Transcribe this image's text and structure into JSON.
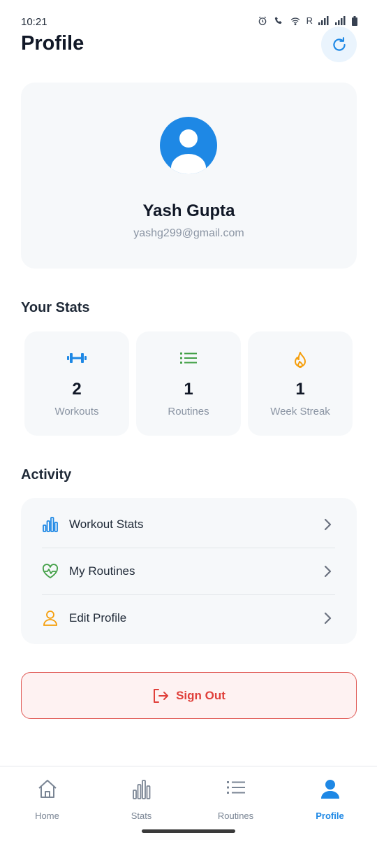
{
  "status_bar": {
    "time": "10:21",
    "carrier_letter": "R"
  },
  "header": {
    "title": "Profile",
    "refresh_icon": "refresh-icon"
  },
  "profile": {
    "name": "Yash Gupta",
    "email": "yashg299@gmail.com",
    "avatar_icon": "user-avatar-icon"
  },
  "stats": {
    "title": "Your Stats",
    "items": [
      {
        "icon": "dumbbell-icon",
        "value": "2",
        "label": "Workouts",
        "color": "#1e88e5"
      },
      {
        "icon": "list-icon",
        "value": "1",
        "label": "Routines",
        "color": "#43a047"
      },
      {
        "icon": "flame-icon",
        "value": "1",
        "label": "Week Streak",
        "color": "#f59e0b"
      }
    ]
  },
  "activity": {
    "title": "Activity",
    "items": [
      {
        "icon": "bar-chart-icon",
        "label": "Workout Stats",
        "color": "#1e88e5"
      },
      {
        "icon": "heart-pulse-icon",
        "label": "My Routines",
        "color": "#43a047"
      },
      {
        "icon": "user-icon",
        "label": "Edit Profile",
        "color": "#f59e0b"
      }
    ]
  },
  "sign_out": {
    "label": "Sign Out",
    "icon": "logout-icon",
    "color": "#e0403b"
  },
  "bottom_nav": {
    "items": [
      {
        "label": "Home",
        "icon": "home-icon"
      },
      {
        "label": "Stats",
        "icon": "bar-chart-icon"
      },
      {
        "label": "Routines",
        "icon": "list-icon"
      },
      {
        "label": "Profile",
        "icon": "person-icon",
        "active": true
      }
    ]
  },
  "colors": {
    "accent": "#1e88e5",
    "danger": "#e0403b",
    "card_bg": "#f6f8fa"
  }
}
